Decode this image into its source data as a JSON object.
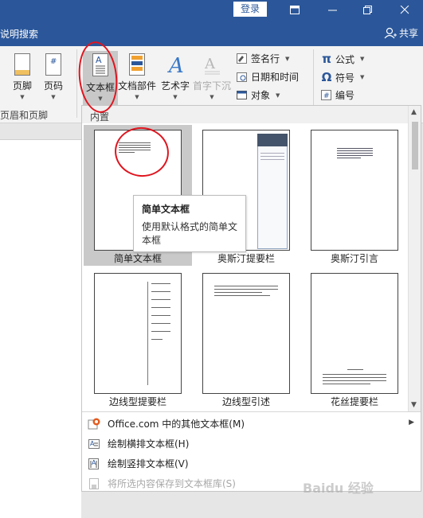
{
  "titlebar": {
    "login_label": "登录"
  },
  "tellme": {
    "label": "说明搜索"
  },
  "share": {
    "label": "共享"
  },
  "ribbon": {
    "footer": "页脚",
    "page_number": "页码",
    "textbox": "文本框",
    "quick_parts": "文档部件",
    "wordart": "艺术字",
    "drop_cap": "首字下沉",
    "signature_line": "签名行",
    "date_time": "日期和时间",
    "object": "对象",
    "equation": "公式",
    "symbol": "符号",
    "numbering": "编号",
    "group_header_footer": "页眉和页脚"
  },
  "gallery": {
    "section_label": "内置",
    "items": [
      {
        "label": "简单文本框"
      },
      {
        "label": "奥斯汀提要栏"
      },
      {
        "label": "奥斯汀引言"
      },
      {
        "label": "边线型提要栏"
      },
      {
        "label": "边线型引述"
      },
      {
        "label": "花丝提要栏"
      }
    ]
  },
  "tooltip": {
    "title": "简单文本框",
    "body": "使用默认格式的简单文本框"
  },
  "menu": {
    "office_more": "Office.com 中的其他文本框(M)",
    "draw_horizontal": "绘制横排文本框(H)",
    "draw_vertical": "绘制竖排文本框(V)",
    "save_selection": "将所选内容保存到文本框库(S)"
  },
  "watermark": {
    "text": "Baidu 经验"
  },
  "colors": {
    "accent": "#2b579a",
    "annotation": "#e0141e"
  }
}
